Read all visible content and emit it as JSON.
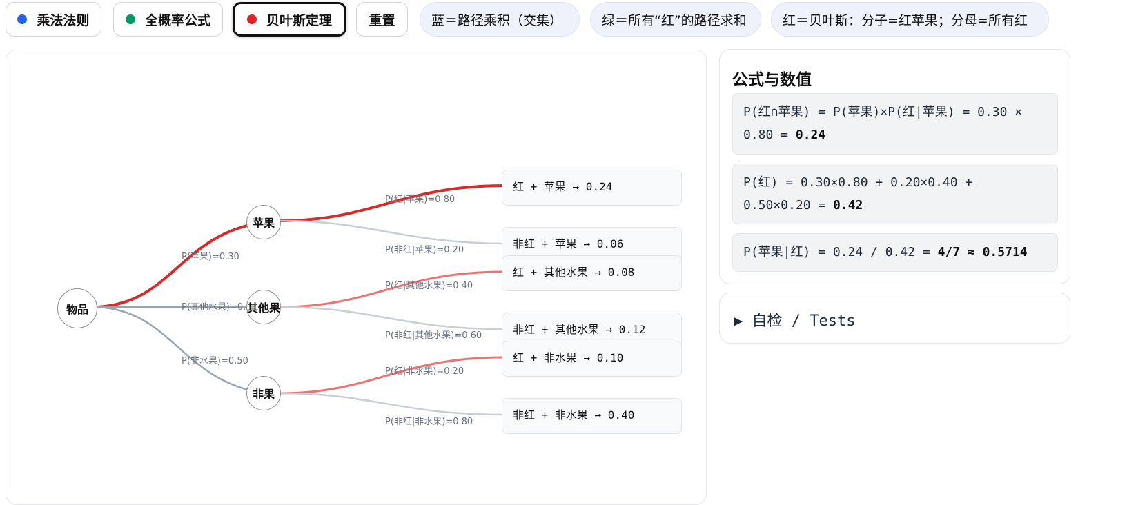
{
  "toolbar": {
    "buttons": [
      {
        "label": "乘法法则",
        "dot_color": "#2563eb"
      },
      {
        "label": "全概率公式",
        "dot_color": "#059669"
      },
      {
        "label": "贝叶斯定理",
        "dot_color": "#dc2626"
      },
      {
        "label": "重置"
      }
    ],
    "legend": [
      "蓝＝路径乘积（交集）",
      "绿＝所有“红”的路径求和",
      "红＝贝叶斯：分子=红苹果；分母=所有红"
    ]
  },
  "tree": {
    "root": "物品",
    "level1": [
      "苹果",
      "其他果",
      "非果"
    ],
    "level1_edges": [
      "P(苹果)=0.30",
      "P(其他水果)=0.20",
      "P(非水果)=0.50"
    ],
    "level2_edges": [
      "P(红|苹果)=0.80",
      "P(非红|苹果)=0.20",
      "P(红|其他水果)=0.40",
      "P(非红|其他水果)=0.60",
      "P(红|非水果)=0.20",
      "P(非红|非水果)=0.80"
    ],
    "leaves": [
      "红 + 苹果 → 0.24",
      "非红 + 苹果 → 0.06",
      "红 + 其他水果 → 0.08",
      "非红 + 其他水果 → 0.12",
      "红 + 非水果 → 0.10",
      "非红 + 非水果 → 0.40"
    ],
    "colors": {
      "bayes_numerator": "#d62b2b",
      "bayes_denominator": "#ef7272",
      "inactive": "#c9ced6",
      "level1_inactive": "#9aa3b2"
    }
  },
  "formulas": {
    "title": "公式与数值",
    "f1_text": "P(红∩苹果) = P(苹果)×P(红|苹果) = 0.30 × 0.80 = ",
    "f1_result": "0.24",
    "f2_text": "P(红) = 0.30×0.80 + 0.20×0.40 + 0.50×0.20 = ",
    "f2_result": "0.42",
    "f3_text": "P(苹果|红) = 0.24 / 0.42 = ",
    "f3_result": "4/7 ≈ 0.5714"
  },
  "tests": {
    "label": "▶ 自检 / Tests"
  }
}
